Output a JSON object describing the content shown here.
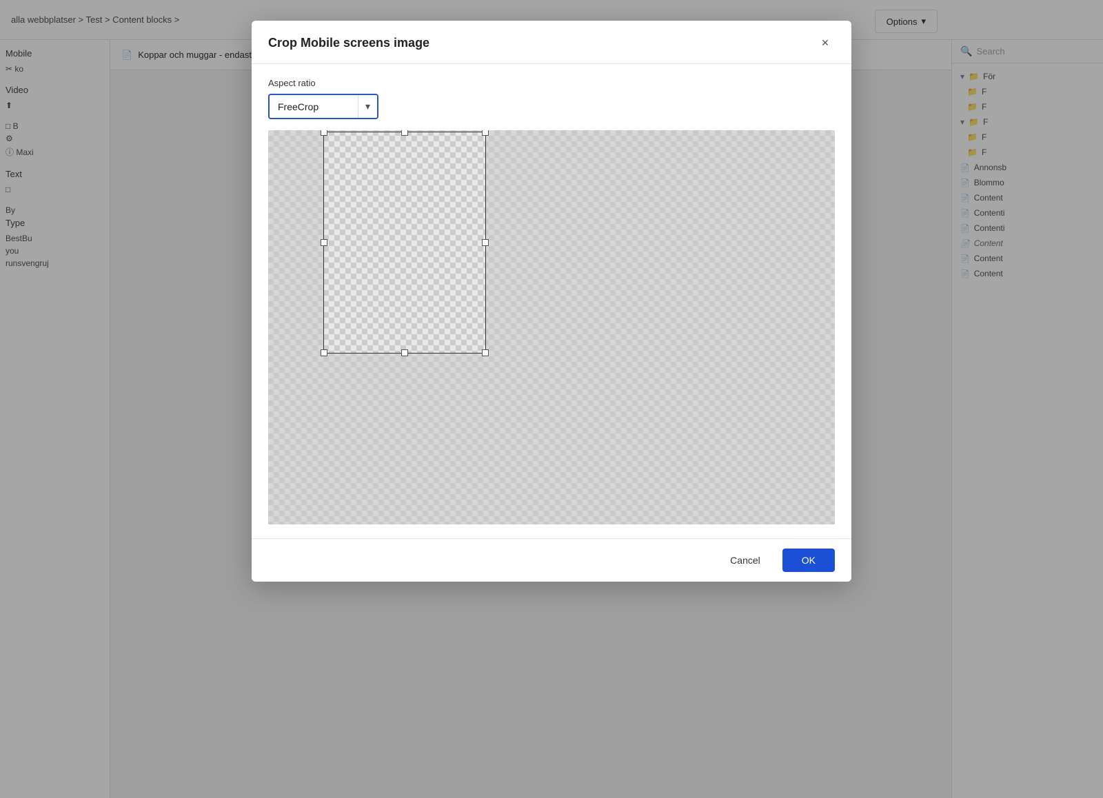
{
  "topbar": {
    "breadcrumb": "alla webbplatser > Test > Content blocks >",
    "options_label": "Options"
  },
  "page_title": {
    "icon": "📄",
    "title": "Koppar och muggar - endast bild"
  },
  "search": {
    "placeholder": "Search"
  },
  "left_panel": {
    "mobile_label": "Mobile",
    "video_label": "Video",
    "text_label": "Text",
    "by_label": "By",
    "type_label": "Type",
    "type_value": "BestBu",
    "user_label": "you",
    "group_label": "runsvengruj"
  },
  "right_sidebar": {
    "items": [
      {
        "type": "folder-expand",
        "label": "För"
      },
      {
        "type": "folder",
        "label": "F"
      },
      {
        "type": "folder",
        "label": "F"
      },
      {
        "type": "folder-expand",
        "label": "F"
      },
      {
        "type": "folder",
        "label": "F"
      },
      {
        "type": "folder",
        "label": "F"
      },
      {
        "type": "file",
        "label": "Annonsb"
      },
      {
        "type": "file",
        "label": "Blommo"
      },
      {
        "type": "file",
        "label": "Content"
      },
      {
        "type": "file",
        "label": "Contenti"
      },
      {
        "type": "file",
        "label": "Contenti"
      },
      {
        "type": "file-italic",
        "label": "Content"
      },
      {
        "type": "file",
        "label": "Content"
      },
      {
        "type": "file",
        "label": "Content"
      }
    ]
  },
  "modal": {
    "title": "Crop Mobile screens image",
    "close_label": "×",
    "aspect_ratio_label": "Aspect ratio",
    "aspect_ratio_value": "FreeCrop",
    "cancel_label": "Cancel",
    "ok_label": "OK"
  }
}
